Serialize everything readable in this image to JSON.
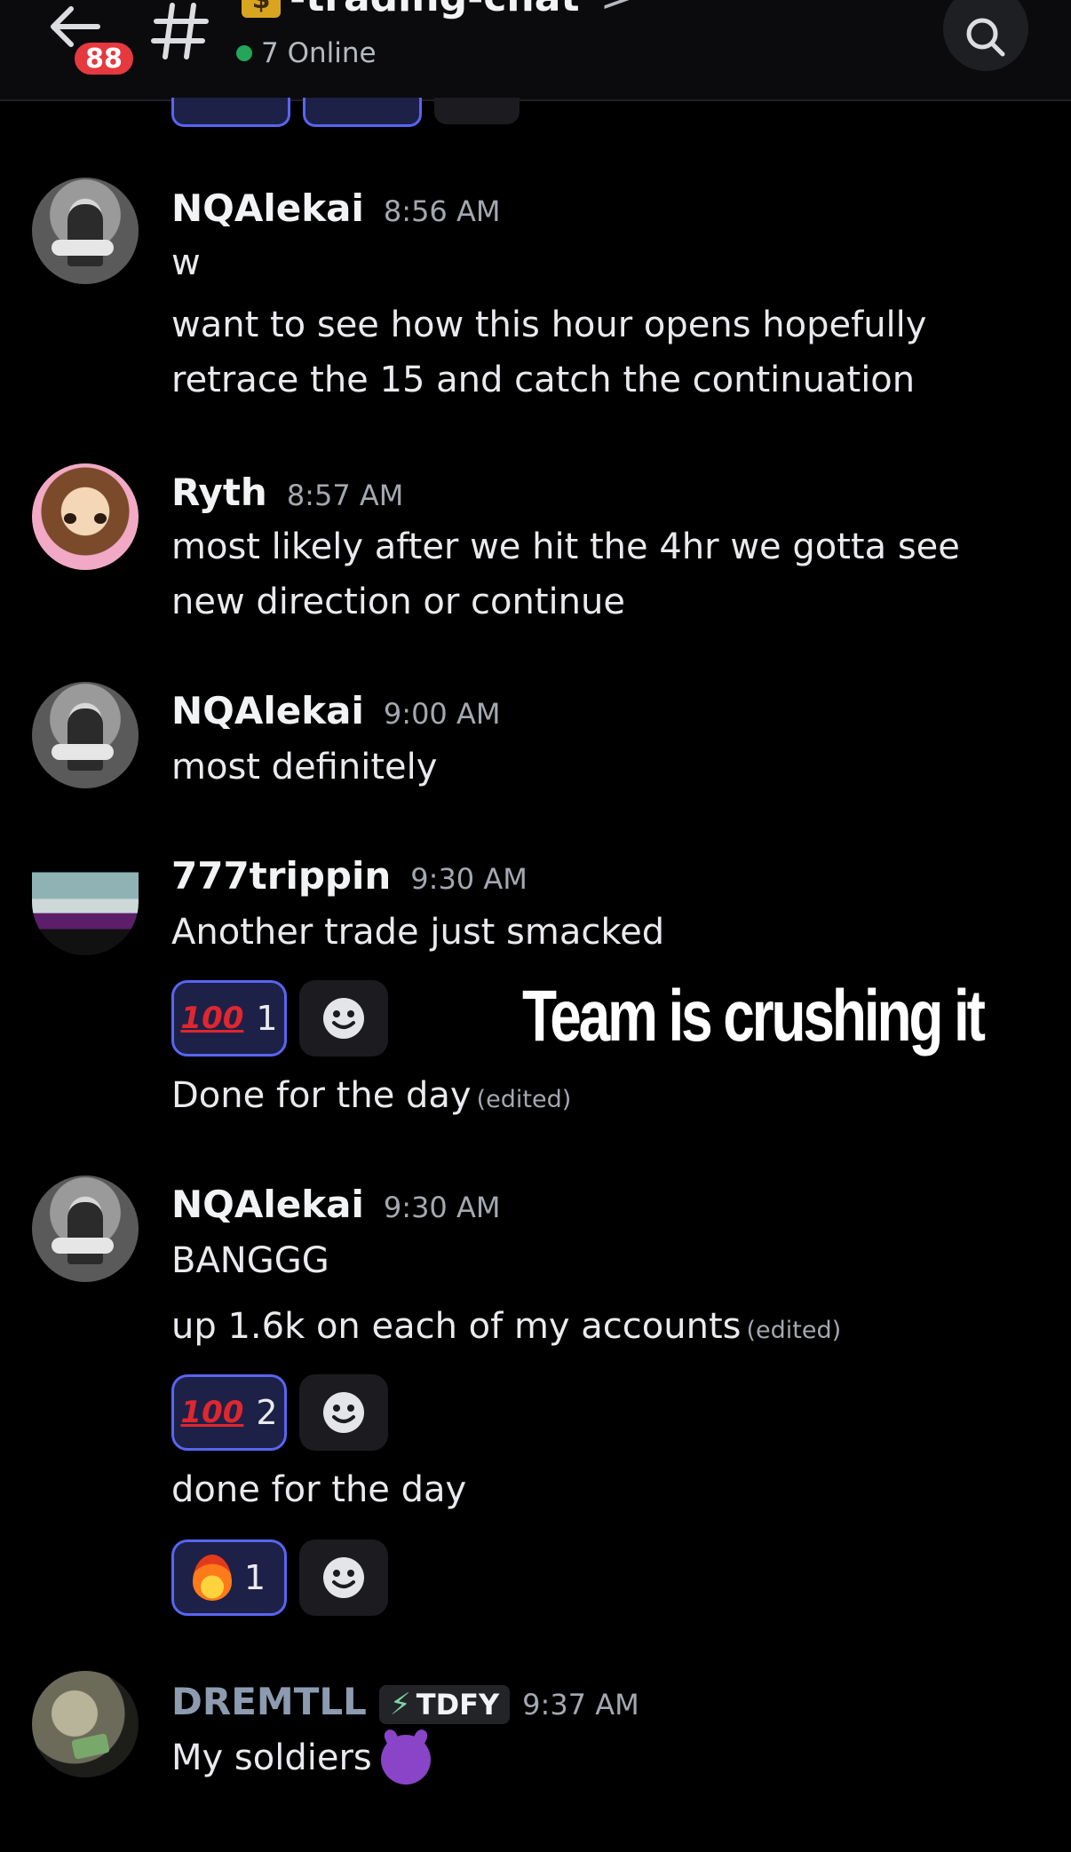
{
  "header": {
    "unread_count": "88",
    "channel_emoji": "$",
    "channel_name": "-trading-chat",
    "chevron": ">",
    "online_text": "7 Online"
  },
  "colors": {
    "background": "#000000",
    "accent": "#5865f2",
    "online": "#23a55a",
    "badge": "#e5393f"
  },
  "messages": [
    {
      "username": "NQAlekai",
      "time": "8:56 AM",
      "lines": [
        "w",
        "want to see how this hour opens hopefully",
        "retrace the 15 and catch the continuation"
      ]
    },
    {
      "username": "Ryth",
      "time": "8:57 AM",
      "lines": [
        "most likely after we hit the 4hr we gotta see",
        "new direction or continue"
      ]
    },
    {
      "username": "NQAlekai",
      "time": "9:00 AM",
      "lines": [
        "most definitely"
      ]
    },
    {
      "username": "777trippin",
      "time": "9:30 AM",
      "lines": [
        "Another trade just smacked",
        "Done for the day"
      ],
      "edited": "(edited)",
      "reaction": {
        "emoji": "100",
        "count": "1"
      }
    },
    {
      "username": "NQAlekai",
      "time": "9:30 AM",
      "lines": [
        "BANGGG",
        "up 1.6k on each of my accounts",
        "done for the day"
      ],
      "edited": "(edited)",
      "reactions": [
        {
          "emoji": "100",
          "count": "2"
        },
        {
          "emoji": "fire",
          "count": "1"
        }
      ]
    },
    {
      "username": "DREMTLL",
      "tag": "TDFY",
      "time": "9:37 AM",
      "lines": [
        "My soldiers"
      ]
    }
  ],
  "overlay_caption": "Team is crushing it"
}
